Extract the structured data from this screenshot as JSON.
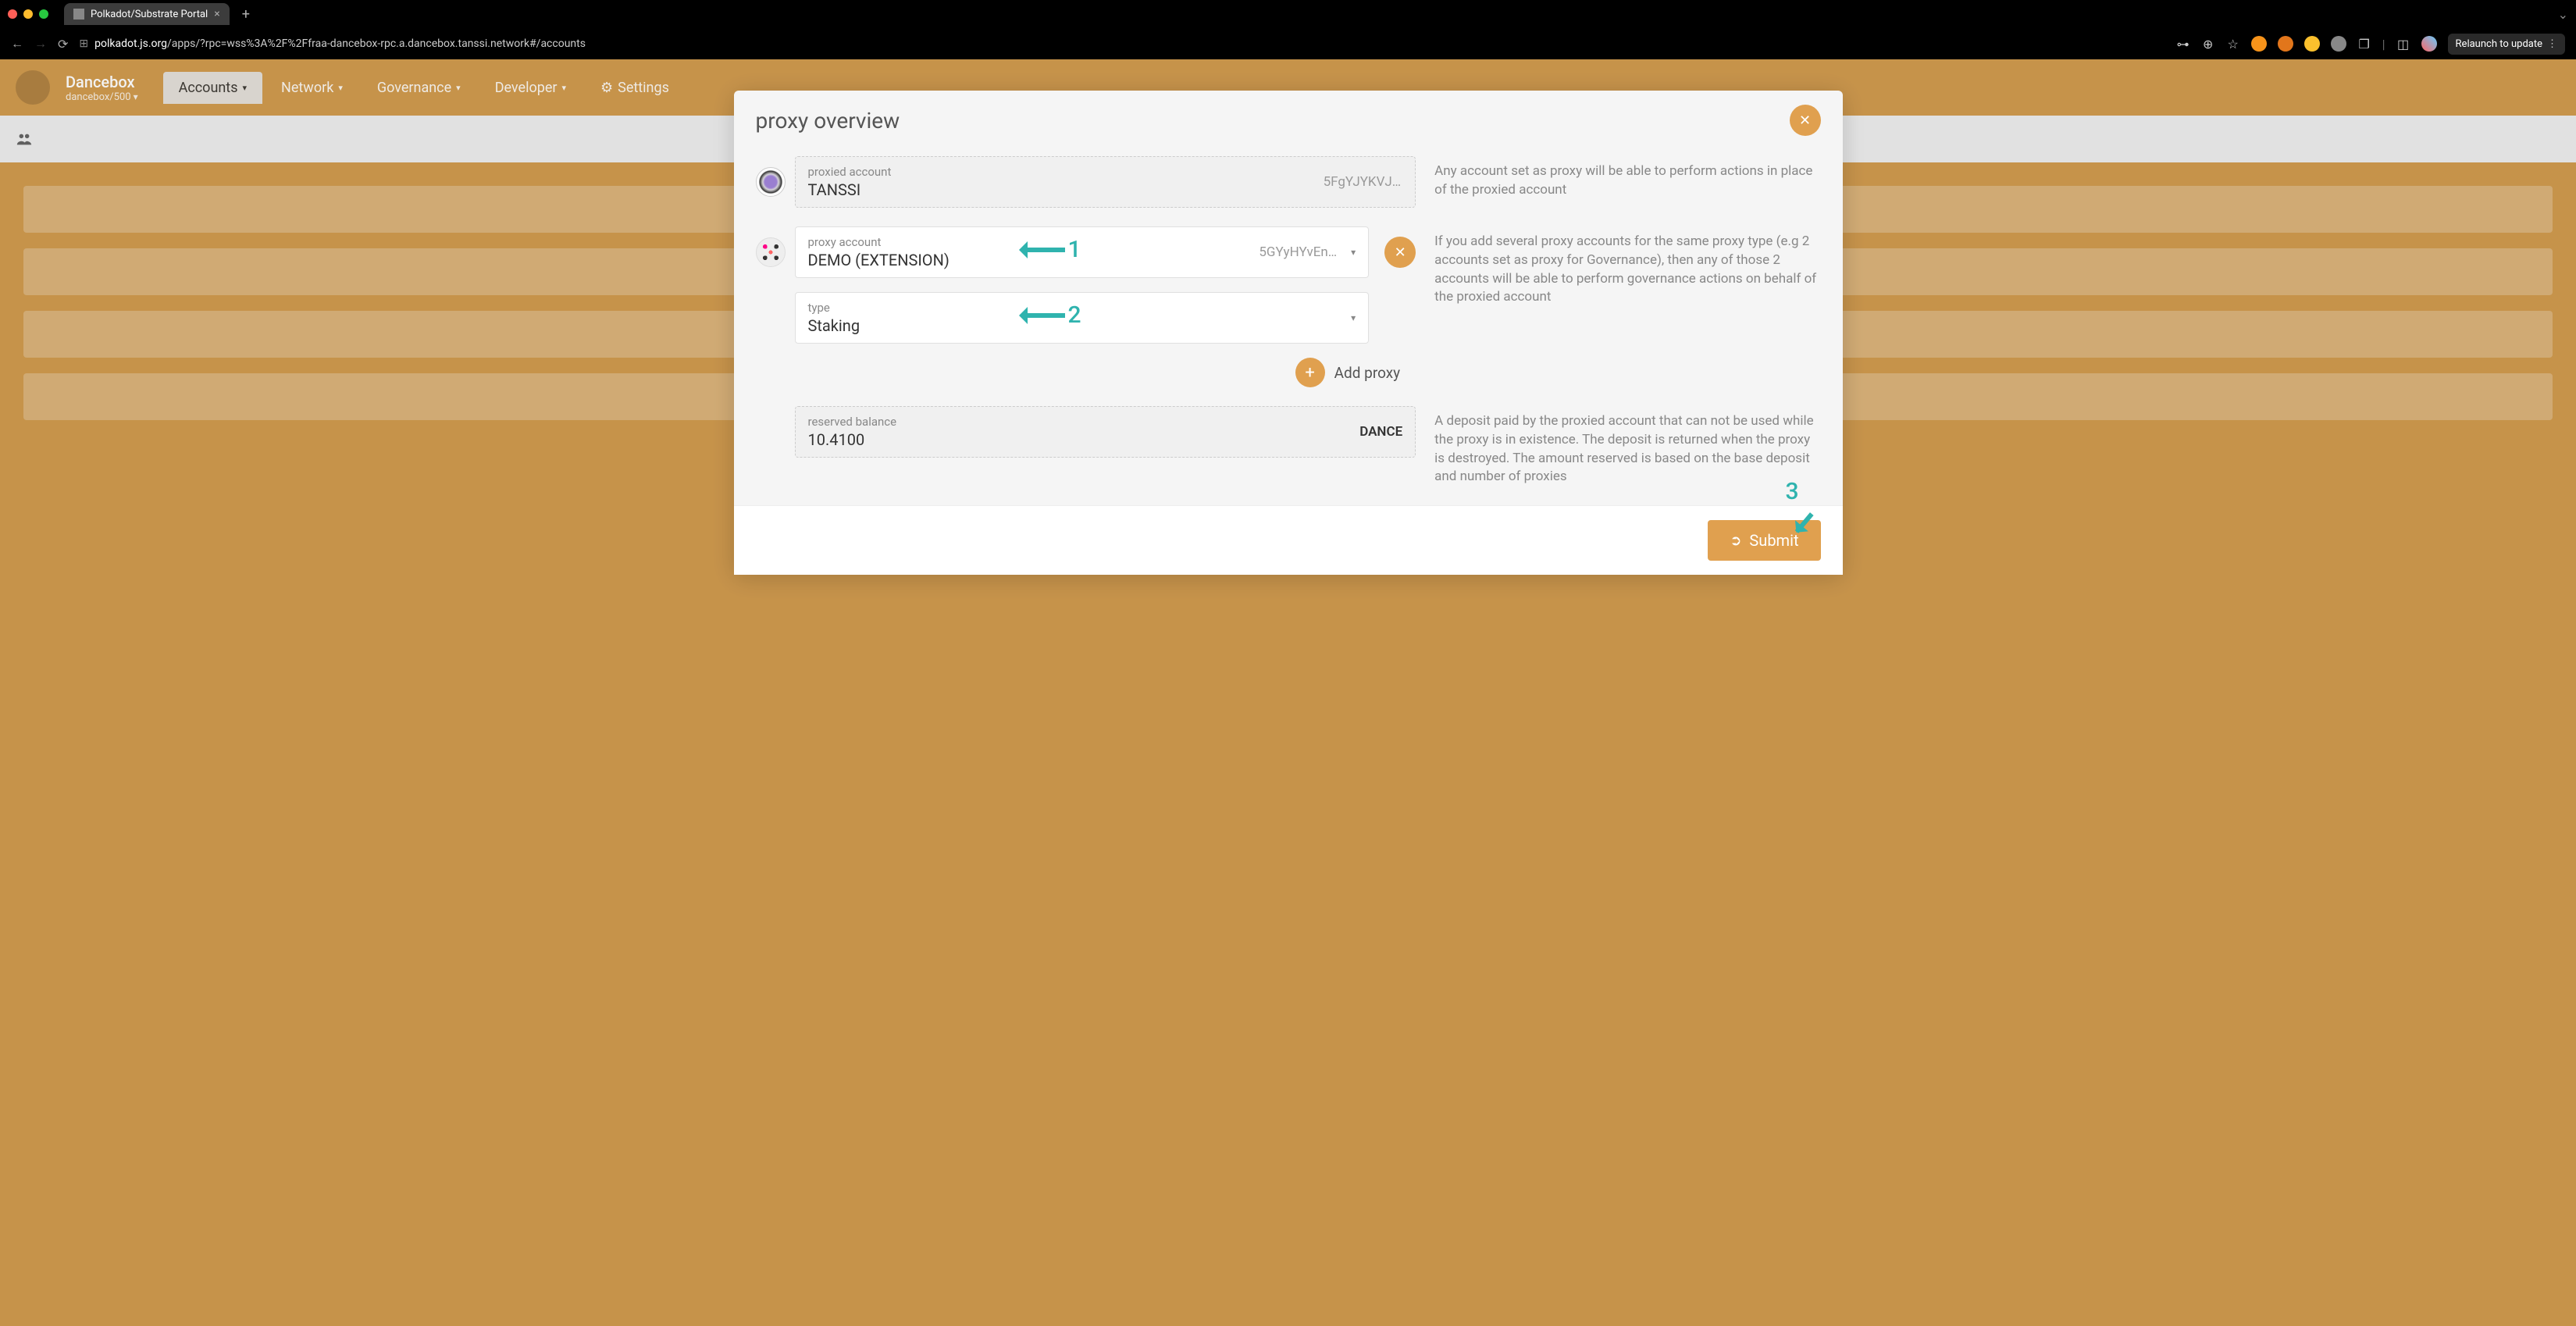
{
  "browser": {
    "tab_title": "Polkadot/Substrate Portal",
    "url_host": "polkadot.js.org",
    "url_path": "/apps/?rpc=wss%3A%2F%2Ffraa-dancebox-rpc.a.dancebox.tanssi.network#/accounts",
    "relaunch_label": "Relaunch to update"
  },
  "topnav": {
    "chain_name": "Dancebox",
    "chain_sub": "dancebox/500",
    "tabs": {
      "accounts": "Accounts",
      "network": "Network",
      "governance": "Governance",
      "developer": "Developer",
      "settings": "Settings"
    }
  },
  "modal": {
    "title": "proxy overview",
    "proxied": {
      "label": "proxied account",
      "name": "TANSSI",
      "address": "5FgYJYKVJ…"
    },
    "proxied_desc": "Any account set as proxy will be able to perform actions in place of the proxied account",
    "proxy": {
      "label": "proxy account",
      "name": "DEMO (EXTENSION)",
      "address": "5GYyHYvEn…"
    },
    "type": {
      "label": "type",
      "value": "Staking"
    },
    "proxy_desc": "If you add several proxy accounts for the same proxy type (e.g 2 accounts set as proxy for Governance), then any of those 2 accounts will be able to perform governance actions on behalf of the proxied account",
    "add_proxy": "Add proxy",
    "reserved": {
      "label": "reserved balance",
      "value": "10.4100",
      "token": "DANCE"
    },
    "reserved_desc": "A deposit paid by the proxied account that can not be used while the proxy is in existence. The deposit is returned when the proxy is destroyed. The amount reserved is based on the base deposit and number of proxies",
    "submit": "Submit"
  },
  "annotations": {
    "a1": "1",
    "a2": "2",
    "a3": "3"
  }
}
